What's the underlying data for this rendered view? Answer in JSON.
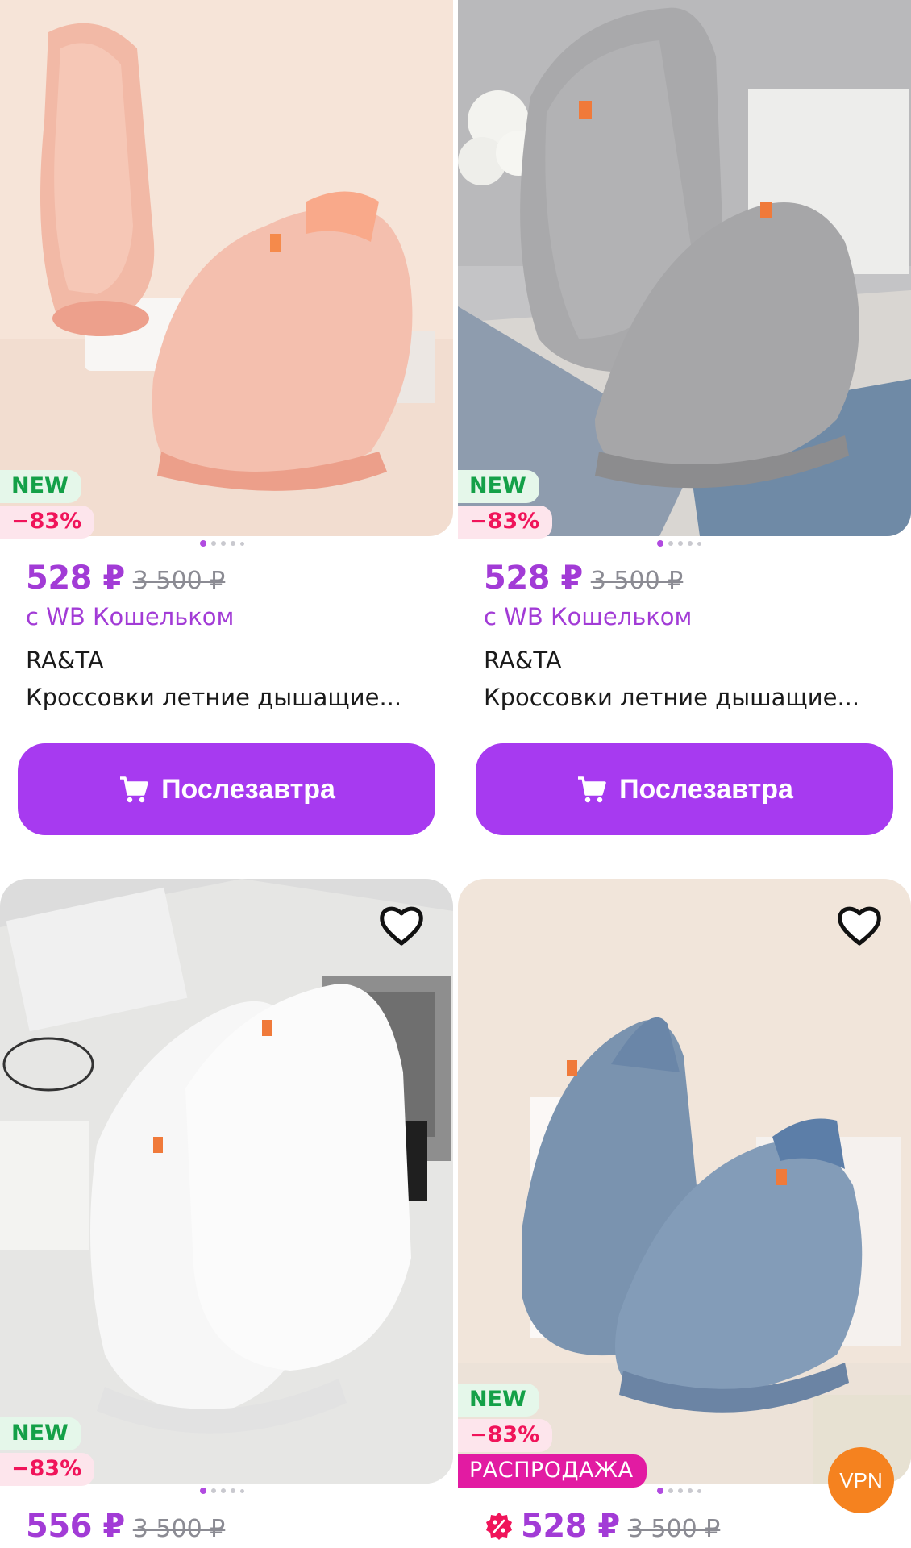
{
  "products": [
    {
      "badges": {
        "new": "NEW",
        "discount": "−83%"
      },
      "price": "528 ₽",
      "old_price": "3 500 ₽",
      "wallet_note": "с WB Кошельком",
      "brand": "RA&TA",
      "title": "Кроссовки летние дышащие...",
      "button_label": "Послезавтра",
      "color": "pink"
    },
    {
      "badges": {
        "new": "NEW",
        "discount": "−83%"
      },
      "price": "528 ₽",
      "old_price": "3 500 ₽",
      "wallet_note": "с WB Кошельком",
      "brand": "RA&TA",
      "title": "Кроссовки летние дышащие...",
      "button_label": "Послезавтра",
      "color": "gray"
    },
    {
      "badges": {
        "new": "NEW",
        "discount": "−83%"
      },
      "price": "556 ₽",
      "old_price": "3 500 ₽",
      "color": "white"
    },
    {
      "badges": {
        "new": "NEW",
        "discount": "−83%",
        "sale": "РАСПРОДАЖА"
      },
      "price": "528 ₽",
      "old_price": "3 500 ₽",
      "color": "blue"
    }
  ],
  "floating": {
    "vpn_label": "VPN"
  },
  "colors": {
    "accent": "#a73af0",
    "price": "#a23bd6",
    "new_badge": "#14a048",
    "discount_badge": "#f0145a",
    "sale_badge": "#e21ba2"
  }
}
